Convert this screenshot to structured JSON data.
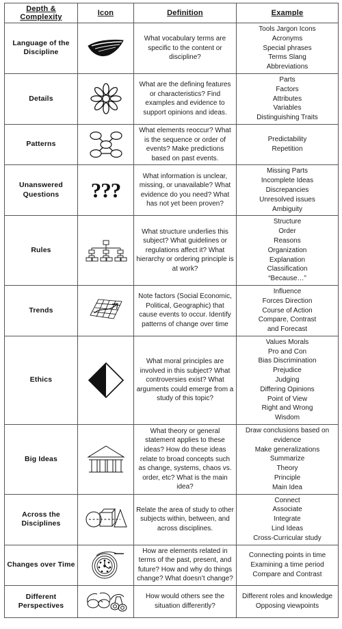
{
  "header": {
    "columns": [
      {
        "label": "Depth & Complexity",
        "name": "col-depth-complexity"
      },
      {
        "label": "Icon",
        "name": "col-icon"
      },
      {
        "label": "Definition",
        "name": "col-definition"
      },
      {
        "label": "Example",
        "name": "col-example"
      }
    ]
  },
  "rows": [
    {
      "concept": "Language of the Discipline",
      "icon_name": "lips-icon",
      "definition": "What vocabulary terms are specific to the content or discipline?",
      "examples": [
        "Tools Jargon Icons",
        "Acronyms",
        "Special phrases",
        "Terms Slang",
        "Abbreviations"
      ]
    },
    {
      "concept": "Details",
      "icon_name": "flower-icon",
      "definition": "What are the defining features or characteristics? Find examples and evidence to support opinions and ideas.",
      "examples": [
        "Parts",
        "Factors",
        "Attributes",
        "Variables",
        "Distinguishing Traits"
      ]
    },
    {
      "concept": "Patterns",
      "icon_name": "network-nodes-icon",
      "definition": "What elements reoccur? What is the sequence or order of events? Make predictions based on past events.",
      "examples": [
        "Predictability",
        "Repetition"
      ]
    },
    {
      "concept": "Unanswered Questions",
      "icon_name": "question-marks-icon",
      "definition": "What information is unclear, missing, or unavailable? What evidence do you need? What has not yet been proven?",
      "examples": [
        "Missing Parts",
        "Incomplete Ideas",
        "Discrepancies",
        "Unresolved issues",
        "Ambiguity"
      ]
    },
    {
      "concept": "Rules",
      "icon_name": "hierarchy-chart-icon",
      "definition": "What structure underlies this subject? What guidelines or regulations affect it? What hierarchy or ordering principle is at work?",
      "examples": [
        "Structure",
        "Order",
        "Reasons",
        "Organization",
        "Explanation",
        "Classification",
        "“Because…”"
      ]
    },
    {
      "concept": "Trends",
      "icon_name": "trend-grid-arrow-icon",
      "definition": "Note factors (Social Economic, Political, Geographic) that cause events to occur. Identify patterns of change over time",
      "examples": [
        "Influence",
        "Forces Direction",
        "Course of Action",
        "Compare, Contrast",
        "and Forecast"
      ]
    },
    {
      "concept": "Ethics",
      "icon_name": "half-filled-diamond-icon",
      "definition": "What moral principles are involved in this subject? What controversies exist? What arguments could emerge from a study of this topic?",
      "examples": [
        "Values Morals",
        "Pro and Con",
        "Bias Discrimination",
        "Prejudice",
        "Judging",
        "Differing Opinions",
        "Point of View",
        "Right and Wrong",
        "Wisdom"
      ]
    },
    {
      "concept": "Big Ideas",
      "icon_name": "greek-temple-icon",
      "definition": "What theory or general statement applies to these ideas? How do these ideas relate to broad concepts such as change, systems, chaos vs. order, etc? What is the main idea?",
      "examples": [
        "Draw conclusions based on evidence",
        "Make generalizations",
        "Summarize",
        "Theory",
        "Principle",
        "Main Idea"
      ]
    },
    {
      "concept": "Across the Disciplines",
      "icon_name": "linked-shapes-icon",
      "definition": "Relate the area of study to other subjects within, between, and across disciplines.",
      "examples": [
        "Connect",
        "Associate",
        "Integrate",
        "Lind Ideas",
        "Cross-Curricular study"
      ]
    },
    {
      "concept": "Changes over Time",
      "icon_name": "clock-spiral-icon",
      "definition": "How are elements related in terms of the past, present, and future? How and why do things change? What doesn’t change?",
      "examples": [
        "Connecting points in time",
        "Examining a time period",
        "Compare and Contrast"
      ]
    },
    {
      "concept": "Different Perspectives",
      "icon_name": "glasses-binoculars-icon",
      "definition": "How would others see the situation differently?",
      "examples": [
        "Different roles and knowledge",
        "Opposing viewpoints"
      ]
    }
  ],
  "icons": {
    "question_marks_text": "???"
  },
  "colors": {
    "border": "#555555",
    "text": "#1b1b1b",
    "ink": "#111111"
  }
}
